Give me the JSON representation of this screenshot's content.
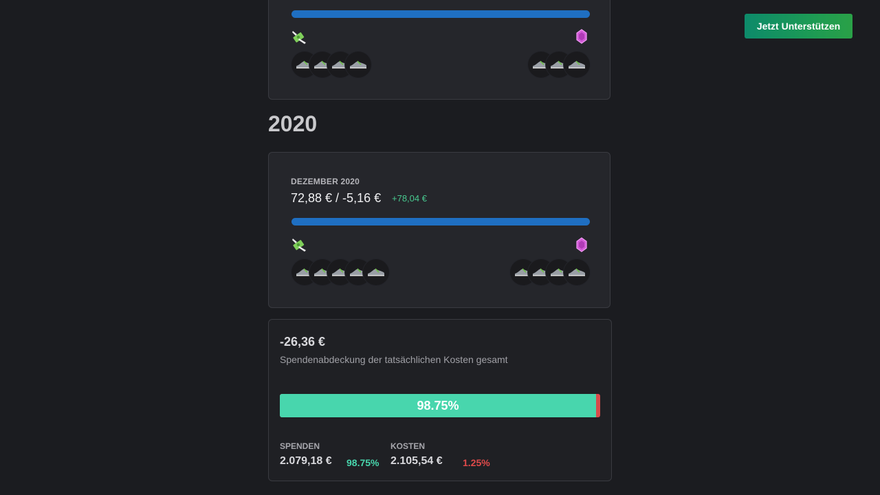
{
  "header": {
    "cta_label": "Jetzt Unterstützen"
  },
  "prev_month": {
    "progress": 1.0,
    "donor_avatars": 4,
    "expense_avatars": 3,
    "donation_icon": "money-with-wings-icon",
    "expense_icon": "gem-icon"
  },
  "year_heading": "2020",
  "december": {
    "month_label": "DEZEMBER 2020",
    "amounts": "72,88 € / -5,16 €",
    "delta": "+78,04 €",
    "progress": 1.0,
    "donor_avatars": 5,
    "expense_avatars": 4
  },
  "summary": {
    "total": "-26,36 €",
    "subtitle": "Spendenabdeckung der tatsächlichen Kosten gesamt",
    "coverage_label": "98.75%",
    "coverage_fraction": 0.9875,
    "donations": {
      "label": "SPENDEN",
      "value": "2.079,18 €",
      "percent": "98.75%"
    },
    "costs": {
      "label": "KOSTEN",
      "value": "2.105,54 €",
      "percent": "1.25%"
    }
  },
  "colors": {
    "background": "#1b1c20",
    "card": "#25262b",
    "progress": "#1f6fc2",
    "positive": "#48d6ad",
    "negative": "#e04a4a",
    "cta": "#1c9a55"
  }
}
